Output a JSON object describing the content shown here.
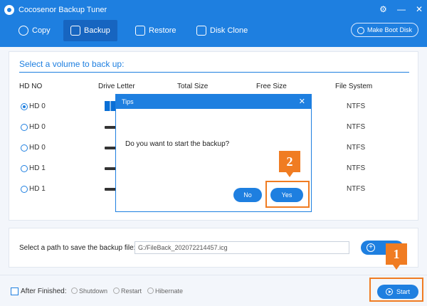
{
  "window": {
    "title": "Cocosenor Backup Tuner",
    "controls": [
      "settings",
      "minimize",
      "close"
    ]
  },
  "toolbar": {
    "tabs": [
      {
        "label": "Copy",
        "icon": "copy-icon"
      },
      {
        "label": "Backup",
        "icon": "backup-icon",
        "active": true
      },
      {
        "label": "Restore",
        "icon": "restore-icon"
      },
      {
        "label": "Disk Clone",
        "icon": "disk-clone-icon"
      }
    ],
    "make_boot_disk": "Make Boot Disk"
  },
  "panel": {
    "title": "Select a volume to back up:",
    "columns": [
      "HD NO",
      "Drive Letter",
      "Total Size",
      "Free Size",
      "File System"
    ],
    "rows": [
      {
        "hd": "HD 0",
        "fs": "NTFS",
        "selected": true,
        "icon": "windows-drive-icon"
      },
      {
        "hd": "HD 0",
        "fs": "NTFS",
        "selected": false,
        "icon": "drive-icon"
      },
      {
        "hd": "HD 0",
        "fs": "NTFS",
        "selected": false,
        "icon": "drive-icon"
      },
      {
        "hd": "HD 1",
        "fs": "NTFS",
        "selected": false,
        "icon": "drive-icon"
      },
      {
        "hd": "HD 1",
        "fs": "NTFS",
        "selected": false,
        "icon": "drive-icon"
      }
    ]
  },
  "path": {
    "label": "Select a path to save the backup file:",
    "value": "G:/FileBack_202072214457.icg"
  },
  "bottom": {
    "after_finished": "After Finished:",
    "options": [
      "Shutdown",
      "Restart",
      "Hibernate"
    ],
    "start": "Start"
  },
  "dialog": {
    "title": "Tips",
    "message": "Do you want to start the backup?",
    "no": "No",
    "yes": "Yes"
  },
  "callouts": {
    "one": "1",
    "two": "2"
  },
  "colors": {
    "accent": "#1e7fe0",
    "highlight": "#f07c22"
  }
}
